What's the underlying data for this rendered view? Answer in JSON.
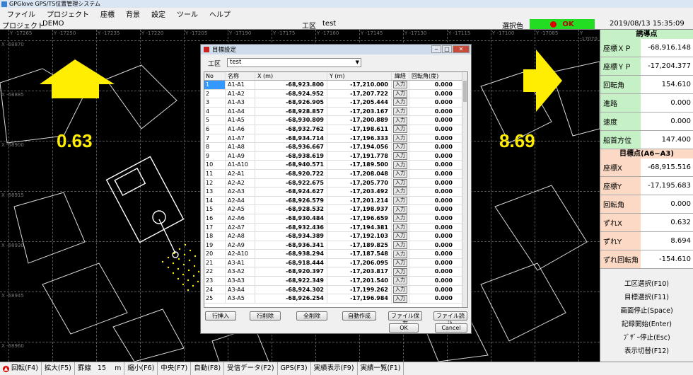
{
  "window": {
    "title": "GPGlove GPS/TS位置管理システム"
  },
  "menu": [
    "ファイル",
    "プロジェクト",
    "座標",
    "背景",
    "設定",
    "ツール",
    "ヘルプ"
  ],
  "info": {
    "project_label": "プロジェクト",
    "project_value": "DEMO",
    "koku_label": "工区",
    "koku_value": "test",
    "selcolor_label": "選択色",
    "status": "OK",
    "datetime": "2019/08/13 15:35:09"
  },
  "map": {
    "left_value": "0.63",
    "right_value": "8.69",
    "grid_x_labels": [
      "Y -17265",
      "Y -17250",
      "Y -17235",
      "Y -17220",
      "Y -17205",
      "Y -17190",
      "Y -17175",
      "Y -17160",
      "Y -17145",
      "Y -17130",
      "Y -17115",
      "Y -17100",
      "Y -17085",
      "Y -17070"
    ],
    "grid_y_labels": [
      "X -68870",
      "X -68885",
      "X -68900",
      "X -68915",
      "X -68930",
      "X -68945",
      "X -68960"
    ]
  },
  "colors": {
    "arrow": "#ffee00",
    "ok_bg": "#22dd22",
    "panel_green": "#c6f0c6",
    "panel_pink": "#fcd9c4"
  },
  "guide": {
    "title": "誘導点",
    "rows": [
      {
        "label": "座標ＸＰ",
        "value": "-68,916.148"
      },
      {
        "label": "座標ＹＰ",
        "value": "-17,204.377"
      },
      {
        "label": "回転角",
        "value": "154.610"
      },
      {
        "label": "進路",
        "value": "0.000"
      },
      {
        "label": "速度",
        "value": "0.000"
      },
      {
        "label": "船首方位",
        "value": "147.400"
      }
    ]
  },
  "target": {
    "title": "目標点(A6−A3)",
    "rows": [
      {
        "label": "座標X",
        "value": "-68,915.516"
      },
      {
        "label": "座標Y",
        "value": "-17,195.683"
      },
      {
        "label": "回転角",
        "value": "0.000"
      },
      {
        "label": "ずれX",
        "value": "0.632"
      },
      {
        "label": "ずれY",
        "value": "8.694"
      },
      {
        "label": "ずれ回転角",
        "value": "-154.610"
      }
    ]
  },
  "commands": [
    "工区選択(F10)",
    "目標選択(F11)",
    "画面停止(Space)",
    "記録開始(Enter)",
    "ﾌﾞｻﾞｰ停止(Esc)",
    "表示切替(F12)"
  ],
  "statusbar": {
    "rotate": "回転(F4)",
    "zoom_in": "拡大(F5)",
    "grid_label": "罫線",
    "grid_value": "15",
    "grid_unit": "m",
    "zoom_out": "縮小(F6)",
    "center": "中央(F7)",
    "auto": "自動(F8)",
    "recv": "受信データ(F2)",
    "gps": "GPS(F3)",
    "actual_show": "実績表示(F9)",
    "actual_list": "実績一覧(F1)"
  },
  "dialog": {
    "title": "目標設定",
    "koku_label": "工区",
    "koku_value": "test",
    "columns": {
      "no": "No",
      "name": "名称",
      "x": "X (m)",
      "y": "Y (m)",
      "input": "緯経",
      "rot": "回転角(度)"
    },
    "input_label": "入力",
    "rows": [
      {
        "no": "1",
        "name": "A1-A1",
        "x": "-68,923.800",
        "y": "-17,210.000",
        "rot": "0.000"
      },
      {
        "no": "2",
        "name": "A1-A2",
        "x": "-68,924.952",
        "y": "-17,207.722",
        "rot": "0.000"
      },
      {
        "no": "3",
        "name": "A1-A3",
        "x": "-68,926.905",
        "y": "-17,205.444",
        "rot": "0.000"
      },
      {
        "no": "4",
        "name": "A1-A4",
        "x": "-68,928.857",
        "y": "-17,203.167",
        "rot": "0.000"
      },
      {
        "no": "5",
        "name": "A1-A5",
        "x": "-68,930.809",
        "y": "-17,200.889",
        "rot": "0.000"
      },
      {
        "no": "6",
        "name": "A1-A6",
        "x": "-68,932.762",
        "y": "-17,198.611",
        "rot": "0.000"
      },
      {
        "no": "7",
        "name": "A1-A7",
        "x": "-68,934.714",
        "y": "-17,196.333",
        "rot": "0.000"
      },
      {
        "no": "8",
        "name": "A1-A8",
        "x": "-68,936.667",
        "y": "-17,194.056",
        "rot": "0.000"
      },
      {
        "no": "9",
        "name": "A1-A9",
        "x": "-68,938.619",
        "y": "-17,191.778",
        "rot": "0.000"
      },
      {
        "no": "10",
        "name": "A1-A10",
        "x": "-68,940.571",
        "y": "-17,189.500",
        "rot": "0.000"
      },
      {
        "no": "11",
        "name": "A2-A1",
        "x": "-68,920.722",
        "y": "-17,208.048",
        "rot": "0.000"
      },
      {
        "no": "12",
        "name": "A2-A2",
        "x": "-68,922.675",
        "y": "-17,205.770",
        "rot": "0.000"
      },
      {
        "no": "13",
        "name": "A2-A3",
        "x": "-68,924.627",
        "y": "-17,203.492",
        "rot": "0.000"
      },
      {
        "no": "14",
        "name": "A2-A4",
        "x": "-68,926.579",
        "y": "-17,201.214",
        "rot": "0.000"
      },
      {
        "no": "15",
        "name": "A2-A5",
        "x": "-68,928.532",
        "y": "-17,198.937",
        "rot": "0.000"
      },
      {
        "no": "16",
        "name": "A2-A6",
        "x": "-68,930.484",
        "y": "-17,196.659",
        "rot": "0.000"
      },
      {
        "no": "17",
        "name": "A2-A7",
        "x": "-68,932.436",
        "y": "-17,194.381",
        "rot": "0.000"
      },
      {
        "no": "18",
        "name": "A2-A8",
        "x": "-68,934.389",
        "y": "-17,192.103",
        "rot": "0.000"
      },
      {
        "no": "19",
        "name": "A2-A9",
        "x": "-68,936.341",
        "y": "-17,189.825",
        "rot": "0.000"
      },
      {
        "no": "20",
        "name": "A2-A10",
        "x": "-68,938.294",
        "y": "-17,187.548",
        "rot": "0.000"
      },
      {
        "no": "21",
        "name": "A3-A1",
        "x": "-68,918.444",
        "y": "-17,206.095",
        "rot": "0.000"
      },
      {
        "no": "22",
        "name": "A3-A2",
        "x": "-68,920.397",
        "y": "-17,203.817",
        "rot": "0.000"
      },
      {
        "no": "23",
        "name": "A3-A3",
        "x": "-68,922.349",
        "y": "-17,201.540",
        "rot": "0.000"
      },
      {
        "no": "24",
        "name": "A3-A4",
        "x": "-68,924.302",
        "y": "-17,199.262",
        "rot": "0.000"
      },
      {
        "no": "25",
        "name": "A3-A5",
        "x": "-68,926.254",
        "y": "-17,196.984",
        "rot": "0.000"
      }
    ],
    "buttons": {
      "insert": "行挿入",
      "delete": "行削除",
      "delete_all": "全削除",
      "auto": "自動作成",
      "save": "ファイル保存",
      "load": "ファイル読込",
      "ok": "OK",
      "cancel": "Cancel"
    }
  }
}
